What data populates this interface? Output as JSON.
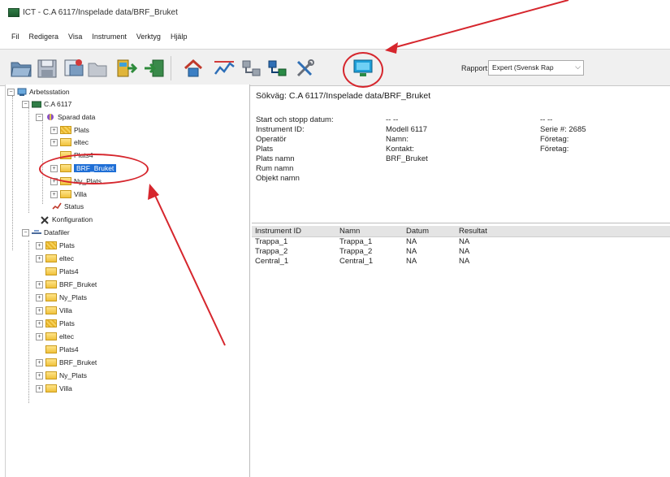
{
  "window": {
    "title": "ICT - C.A 6117/Inspelade data/BRF_Bruket"
  },
  "menu": [
    "Fil",
    "Redigera",
    "Visa",
    "Instrument",
    "Verktyg",
    "Hjälp"
  ],
  "toolbar": {
    "report_label": "Rapport:",
    "report_value": "Expert (Svensk Rap",
    "icons": [
      "open-folder-icon",
      "save-icon",
      "print-icon",
      "folder-icon",
      "import-icon",
      "export-icon",
      "home-icon",
      "chart-icon",
      "network-icon",
      "network-alt-icon",
      "tools-icon",
      "connect-monitor-icon"
    ]
  },
  "tree": {
    "root": "Arbetsstation",
    "device": "C.A 6117",
    "saved_data": "Sparad data",
    "saved_items": [
      "Plats",
      "eltec",
      "Plats4",
      "BRF_Bruket",
      "Ny_Plats",
      "Villa"
    ],
    "status": "Status",
    "config": "Konfiguration",
    "datafiles": "Datafiler",
    "datafile_items": [
      "Plats",
      "eltec",
      "Plats4",
      "BRF_Bruket",
      "Ny_Plats",
      "Villa",
      "Plats",
      "eltec",
      "Plats4",
      "BRF_Bruket",
      "Ny_Plats",
      "Villa"
    ],
    "selected": "BRF_Bruket"
  },
  "details": {
    "path": "Sökväg: C.A 6117/Inspelade data/BRF_Bruket",
    "col1": [
      "Start och stopp datum:",
      "Instrument ID:",
      "Operatör",
      "Plats",
      "Plats namn",
      "Rum namn",
      "Objekt namn"
    ],
    "col2": [
      "-- --",
      "Modell 6117",
      "Namn:",
      "Kontakt:",
      "BRF_Bruket"
    ],
    "col3": [
      "-- --",
      "Serie #: 2685",
      "Företag:",
      "Företag:"
    ]
  },
  "list": {
    "headers": [
      "Instrument ID",
      "Namn",
      "Datum",
      "Resultat"
    ],
    "rows": [
      [
        "Trappa_1",
        "Trappa_1",
        "NA",
        "NA"
      ],
      [
        "Trappa_2",
        "Trappa_2",
        "NA",
        "NA"
      ],
      [
        "Central_1",
        "Central_1",
        "NA",
        "NA"
      ]
    ]
  },
  "colors": {
    "accent": "#1f6fd6",
    "callout": "#d6262d"
  }
}
